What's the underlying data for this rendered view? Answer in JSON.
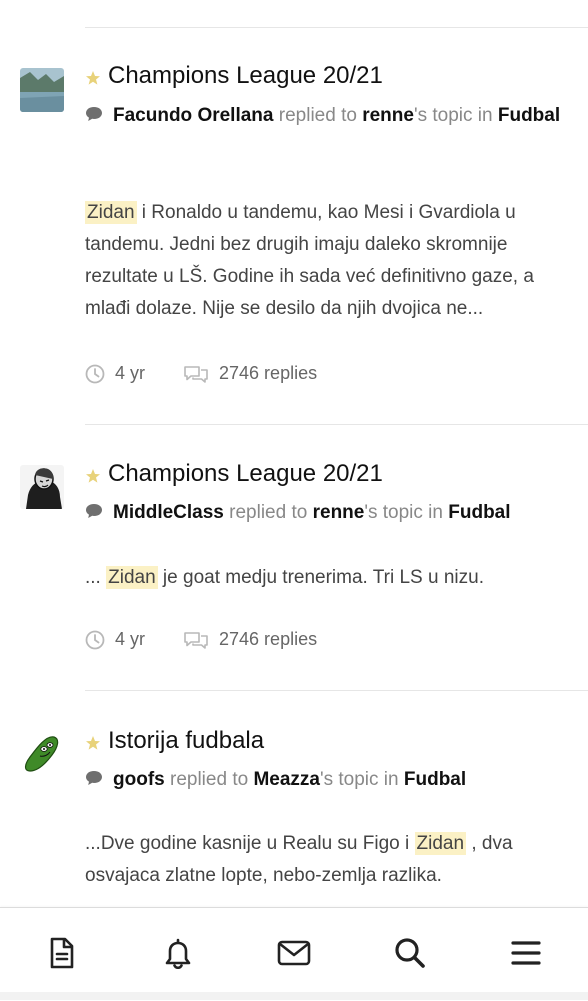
{
  "results": [
    {
      "title": "Champions League 20/21",
      "author": "Facundo Orellana",
      "replied_to": "replied to",
      "topic_owner": "renne",
      "topic_suffix": "'s topic in",
      "forum": "Fudbal",
      "snippet_pre": "",
      "highlight": "Zidan",
      "snippet_post": " i Ronaldo u tandemu, kao Mesi i Gvardiola u tandemu. Jedni bez drugih imaju daleko skromnije rezultate u LŠ. Godine ih sada već definitivno gaze, a mlađi dolaze. Nije se desilo da njih dvojica ne...",
      "time": "4 yr",
      "replies": "2746 replies"
    },
    {
      "title": "Champions League 20/21",
      "author": "MiddleClass",
      "replied_to": "replied to",
      "topic_owner": "renne",
      "topic_suffix": "'s topic in",
      "forum": "Fudbal",
      "snippet_pre": "... ",
      "highlight": "Zidan",
      "snippet_post": " je goat medju trenerima. Tri LS u nizu.",
      "time": "4 yr",
      "replies": "2746 replies"
    },
    {
      "title": "Istorija fudbala",
      "author": "goofs",
      "replied_to": "replied to",
      "topic_owner": "Meazza",
      "topic_suffix": "'s topic in",
      "forum": "Fudbal",
      "snippet_pre": "...Dve godine kasnije u Realu su Figo i ",
      "highlight": "Zidan",
      "snippet_post": " , dva osvajaca zlatne lopte, nebo-zemlja razlika."
    }
  ],
  "bottom_nav": [
    "document-icon",
    "bell-icon",
    "envelope-icon",
    "search-icon",
    "menu-icon"
  ],
  "colors": {
    "highlight": "#fbf1c5",
    "star": "#e8d27a",
    "muted": "#888888"
  }
}
